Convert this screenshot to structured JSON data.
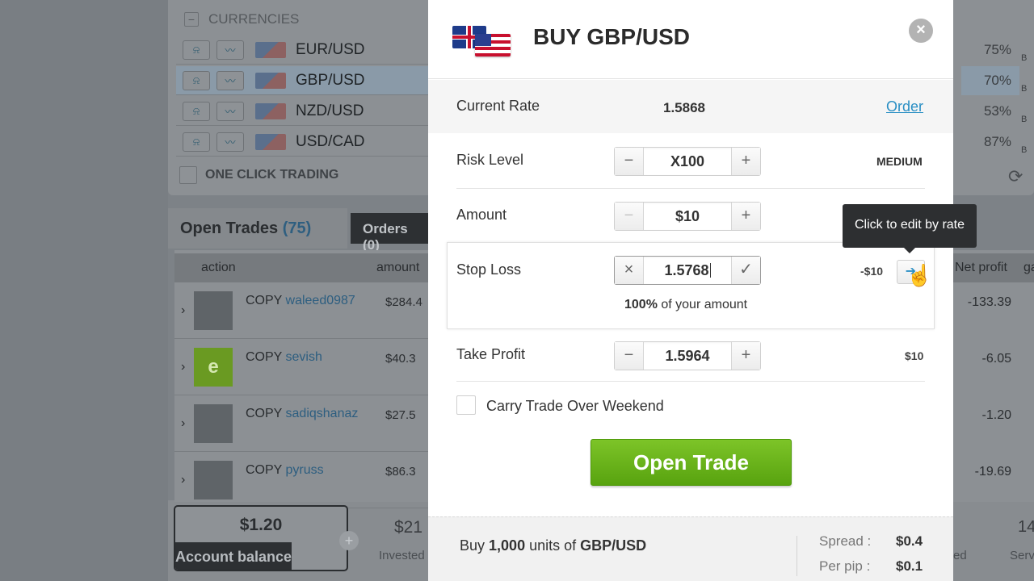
{
  "background": {
    "currencies": {
      "header": "CURRENCIES",
      "rows": [
        {
          "pair": "EUR/USD",
          "pct": "75%",
          "selected": false
        },
        {
          "pair": "GBP/USD",
          "pct": "70%",
          "selected": true
        },
        {
          "pair": "NZD/USD",
          "pct": "53%",
          "selected": false
        },
        {
          "pair": "USD/CAD",
          "pct": "87%",
          "selected": false
        }
      ],
      "pct_suffix": "B",
      "one_click": "ONE CLICK TRADING"
    },
    "open_trades": {
      "tab_label": "Open Trades",
      "tab_count": "(75)",
      "orders_tab": "Orders (0)",
      "col_action": "action",
      "col_amount": "amount",
      "rows": [
        {
          "copy": "COPY",
          "user": "waleed0987",
          "amount": "$284.4",
          "net": "-133.39"
        },
        {
          "copy": "COPY",
          "user": "sevish",
          "amount": "$40.3",
          "net": "-6.05"
        },
        {
          "copy": "COPY",
          "user": "sadiqshanaz",
          "amount": "$27.5",
          "net": "-1.20"
        },
        {
          "copy": "COPY",
          "user": "pyruss",
          "amount": "$86.3",
          "net": "-19.69"
        }
      ],
      "col_net_profit": "Net profit",
      "col_g": "ga"
    },
    "balance": {
      "value": "$1.20",
      "label": "Account balance"
    },
    "invested": {
      "value": "$21",
      "label": "Invested"
    },
    "right_value": "14",
    "right_label": "Serv",
    "right_label2": "ed"
  },
  "modal": {
    "title": "BUY GBP/USD",
    "close": "×",
    "current_rate_label": "Current Rate",
    "current_rate_value": "1.5868",
    "order_link": "Order",
    "risk_label": "Risk Level",
    "risk_value": "X100",
    "risk_level_text": "MEDIUM",
    "amount_label": "Amount",
    "amount_value": "$10",
    "stop_loss_label": "Stop Loss",
    "stop_loss_value": "1.5768",
    "stop_loss_pct": "100%",
    "stop_loss_pct_suffix": " of your amount",
    "stop_loss_money": "-$10",
    "tooltip": "Click to edit by rate",
    "take_profit_label": "Take Profit",
    "take_profit_value": "1.5964",
    "take_profit_money": "$10",
    "weekend_label": "Carry Trade Over Weekend",
    "open_trade_button": "Open Trade",
    "footer": {
      "prefix": "Buy ",
      "units": "1,000",
      "mid": " units of ",
      "pair": "GBP/USD",
      "spread_label": "Spread :",
      "spread_value": "$0.4",
      "per_pip_label": "Per pip :",
      "per_pip_value": "$0.1"
    },
    "steppers": {
      "minus": "−",
      "plus": "+",
      "clear": "×",
      "confirm": "✓"
    }
  }
}
